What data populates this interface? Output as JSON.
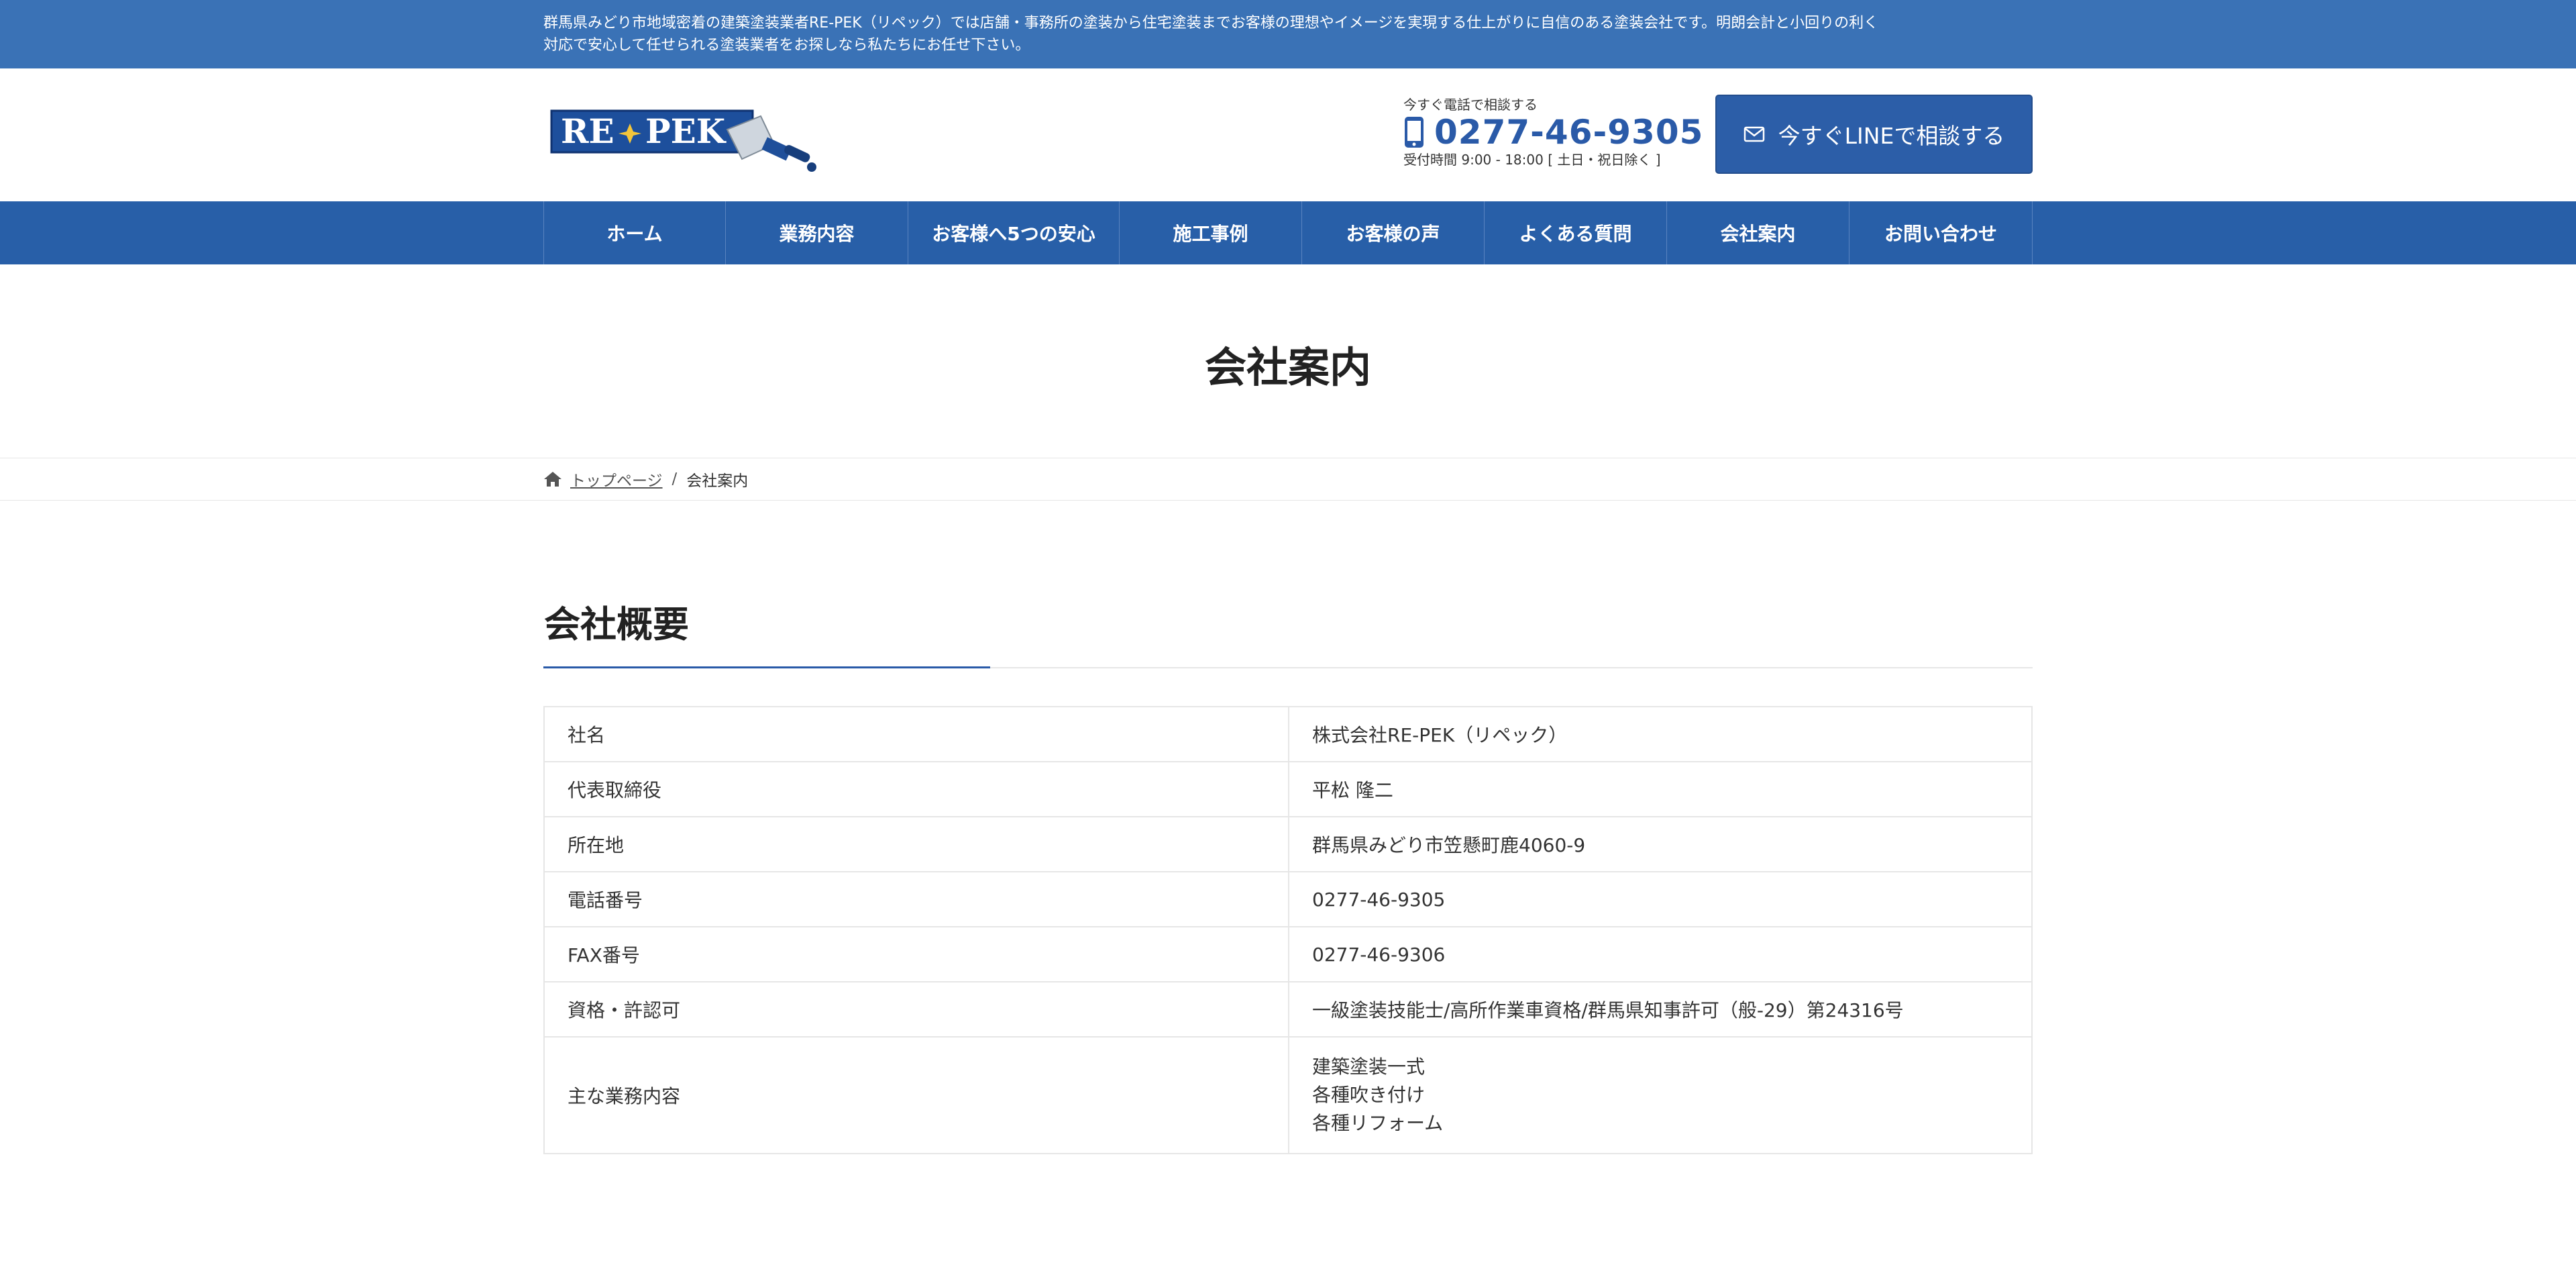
{
  "topbar": {
    "line1": "群馬県みどり市地域密着の建築塗装業者RE-PEK（リペック）では店舗・事務所の塗装から住宅塗装までお客様の理想やイメージを実現する仕上がりに自信のある塗装会社です。明朗会計と小回りの利く",
    "line2": "対応で安心して任せられる塗装業者をお探しなら私たちにお任せ下さい。"
  },
  "header": {
    "logo_text": "RE✦PEK",
    "contact_lead": "今すぐ電話で相談する",
    "phone": "0277-46-9305",
    "hours": "受付時間 9:00 - 18:00 [ 土日・祝日除く ]",
    "line_button": "今すぐLINEで相談する"
  },
  "nav": {
    "items": [
      {
        "label": "ホーム"
      },
      {
        "label": "業務内容"
      },
      {
        "label": "お客様へ5つの安心"
      },
      {
        "label": "施工事例"
      },
      {
        "label": "お客様の声"
      },
      {
        "label": "よくある質問"
      },
      {
        "label": "会社案内"
      },
      {
        "label": "お問い合わせ"
      }
    ]
  },
  "page": {
    "title": "会社案内"
  },
  "breadcrumb": {
    "home": "トップページ",
    "separator": "/",
    "current": "会社案内"
  },
  "section": {
    "heading": "会社概要"
  },
  "company_table": {
    "rows": [
      {
        "label": "社名",
        "value": "株式会社RE-PEK（リペック）"
      },
      {
        "label": "代表取締役",
        "value": "平松 隆二"
      },
      {
        "label": "所在地",
        "value": "群馬県みどり市笠懸町鹿4060-9"
      },
      {
        "label": "電話番号",
        "value": "0277-46-9305"
      },
      {
        "label": "FAX番号",
        "value": "0277-46-9306"
      },
      {
        "label": "資格・許認可",
        "value": "一級塗装技能士/高所作業車資格/群馬県知事許可（般-29）第24316号"
      },
      {
        "label": "主な業務内容",
        "values": [
          "建築塗装一式",
          "各種吹き付け",
          "各種リフォーム"
        ]
      }
    ]
  },
  "colors": {
    "topbar": "#3a72b6",
    "nav": "#285fa8",
    "accent": "#2a5aa8",
    "logo_bg": "#1d4f9c",
    "logo_star": "#f3c53a"
  },
  "icons": {
    "phone": "smartphone-icon",
    "mail": "envelope-icon",
    "home": "home-icon",
    "logo_brush": "paint-brush-icon"
  }
}
